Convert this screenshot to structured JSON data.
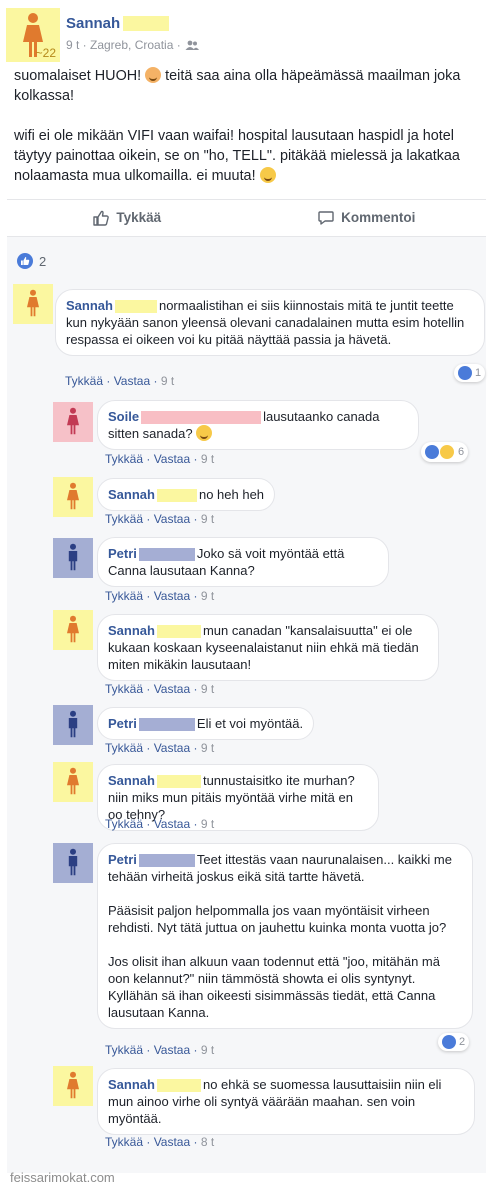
{
  "post": {
    "author": "Sannah",
    "age_badge": "~22",
    "meta": "9 t · Zagreb, Croatia ·",
    "para1_a": "suomalaiset HUOH!",
    "para1_b": "teitä saa aina olla häpeämässä maailman joka kolkassa!",
    "para2": "wifi ei ole mikään VIFI vaan waifai! hospital lausutaan haspidl ja hotel täytyy painottaa oikein, se on \"ho, TELL\". pitäkää mielessä ja lakatkaa nolaamasta mua ulkomailla. ei muuta!"
  },
  "actions": {
    "like_label": "Tykkää",
    "comment_label": "Kommentoi"
  },
  "post_likes": "2",
  "comment_labels": {
    "like": "Tykkää",
    "reply": "Vastaa",
    "sep": " · "
  },
  "comments": [
    {
      "name": "Sannah",
      "text": "normaalistihan ei siis kiinnostais mitä te juntit teette kun nykyään sanon yleensä olevani canadalainen mutta esim hotellin respassa ei oikeen voi ku pitää näyttää passia ja hävetä.",
      "time": "9 t",
      "reactions": "1"
    },
    {
      "name": "Soile",
      "text": "lausutaanko canada sitten sanada?",
      "time": "9 t",
      "reactions": "6"
    },
    {
      "name": "Sannah",
      "text": "no heh heh",
      "time": "9 t"
    },
    {
      "name": "Petri",
      "text": "Joko sä voit myöntää että Canna lausutaan Kanna?",
      "time": "9 t"
    },
    {
      "name": "Sannah",
      "text": "mun canadan \"kansalaisuutta\" ei ole kukaan koskaan kyseenalaistanut niin ehkä mä tiedän miten mikäkin lausutaan!",
      "time": "9 t"
    },
    {
      "name": "Petri",
      "text": "Eli et voi myöntää.",
      "time": "9 t"
    },
    {
      "name": "Sannah",
      "text": "tunnustaisitko ite murhan? niin miks mun pitäis myöntää virhe mitä en oo tehny?",
      "time": "9 t"
    },
    {
      "name": "Petri",
      "text": "Teet ittestäs vaan naurunalaisen... kaikki me tehään virheitä joskus eikä sitä tartte hävetä.",
      "text2": "Pääsisit paljon helpommalla jos vaan myöntäisit virheen rehdisti. Nyt tätä juttua on jauhettu kuinka monta vuotta jo?",
      "text3": "Jos olisit ihan alkuun vaan todennut että \"joo, mitähän mä oon kelannut?\" niin tämmöstä showta ei olis syntynyt. Kyllähän sä ihan oikeesti sisimmässäs tiedät, että Canna lausutaan Kanna.",
      "time": "9 t",
      "reactions": "2"
    },
    {
      "name": "Sannah",
      "text": "no ehkä se suomessa lausuttaisiin niin eli mun ainoo virhe oli syntyä väärään maahan. sen voin myöntää.",
      "time": "8 t"
    }
  ],
  "footer": "feissarimokat.com",
  "colors": {
    "link": "#365899",
    "yellow": "#fbf7a0",
    "pink": "#f6c1c8",
    "blue": "#a4aed3"
  }
}
